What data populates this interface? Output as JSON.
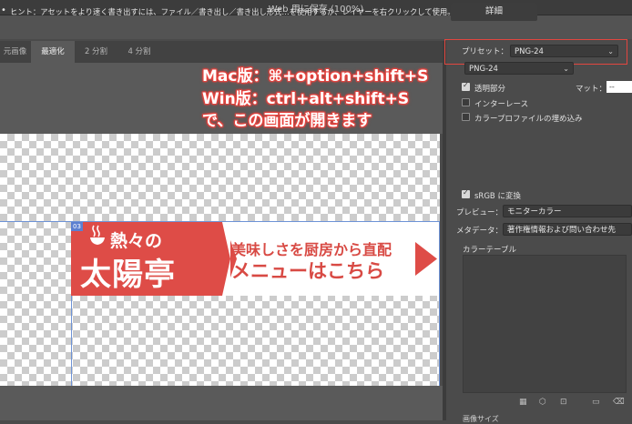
{
  "window": {
    "title": "Web 用に保存 (100%)"
  },
  "hint": {
    "text": "ヒント：アセットをより速く書き出すには、ファイル／書き出し／書き出し形式…を使用するか、レイヤーを右クリックして使用。",
    "detail_button": "詳細"
  },
  "tabs": [
    {
      "label": "元画像",
      "active": false
    },
    {
      "label": "最適化",
      "active": true
    },
    {
      "label": "2 分割",
      "active": false
    },
    {
      "label": "4 分割",
      "active": false
    }
  ],
  "annotation": {
    "line1": "Mac版：⌘+option+shift+S",
    "line2": "Win版：ctrl+alt+shift+S",
    "line3": "で、この画面が開きます"
  },
  "slice": {
    "label": "03"
  },
  "banner": {
    "brand_small": "熱々の",
    "brand_big": "太陽亭",
    "promo_line1": "美味しさを厨房から直配",
    "promo_line2": "メニューはこちら",
    "colors": {
      "red": "#de4c47",
      "white": "#ffffff"
    }
  },
  "settings": {
    "preset_label": "プリセット：",
    "preset_value": "PNG-24",
    "format_value": "PNG-24",
    "transparency": {
      "label": "透明部分",
      "checked": true
    },
    "interlaced": {
      "label": "インターレース",
      "checked": false
    },
    "embed_profile": {
      "label": "カラープロファイルの埋め込み",
      "checked": false
    },
    "matte_label": "マット：",
    "matte_value": "--",
    "srgb": {
      "label": "sRGB に変換",
      "checked": true
    },
    "preview_label": "プレビュー：",
    "preview_value": "モニターカラー",
    "metadata_label": "メタデータ：",
    "metadata_value": "著作権情報および問い合わせ先",
    "color_table_label": "カラーテーブル",
    "image_size_label": "画像サイズ"
  },
  "colors": {
    "accent_red": "#e2463f",
    "panel": "#4b4b4b"
  }
}
